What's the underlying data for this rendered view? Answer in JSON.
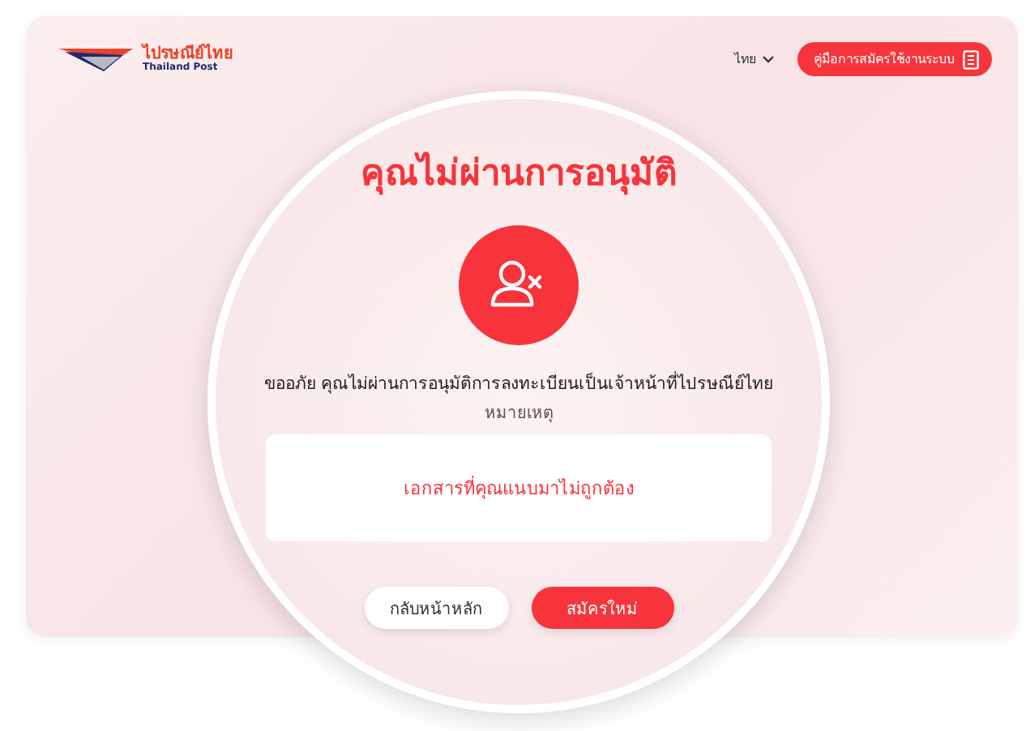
{
  "header": {
    "logo_text": "ไปรษณีย์ไทย",
    "logo_subtext": "Thailand Post",
    "language": "ไทย",
    "manual_button": "คู่มือการสมัครใช้งานระบบ"
  },
  "dialog": {
    "title": "คุณไม่ผ่านการอนุมัติ",
    "message": "ขออภัย คุณไม่ผ่านการอนุมัติการลงทะเบียนเป็นเจ้าหน้าที่ไปรษณีย์ไทย",
    "note_label": "หมายเหตุ",
    "note": "เอกสารที่คุณแนบมาไม่ถูกต้อง",
    "buttons": [
      {
        "label": "กลับหน้าหลัก",
        "kind": "secondary"
      },
      {
        "label": "สมัครใหม่",
        "kind": "primary"
      }
    ]
  }
}
